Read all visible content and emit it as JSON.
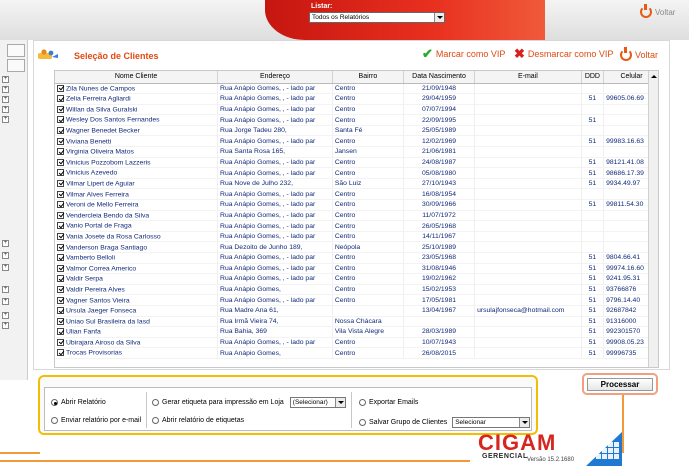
{
  "topbar": {
    "listar_label": "Listar:",
    "listar_value": "Todos os Relatórios",
    "voltar_label": "Voltar"
  },
  "panel": {
    "title": "Seleção de Clientes",
    "marcar_vip": "Marcar como VIP",
    "desmarcar_vip": "Desmarcar como VIP",
    "voltar": "Voltar"
  },
  "table": {
    "columns": [
      "Nome Cliente",
      "Endereço",
      "Bairro",
      "Data Nascimento",
      "E-mail",
      "DDD",
      "Celular"
    ],
    "rows": [
      [
        "Zila Nunes de Campos",
        "Rua Anápio Gomes, , - lado par",
        "Centro",
        "21/09/1948",
        "",
        "",
        ""
      ],
      [
        "Zelia Ferreira Agliardi",
        "Rua Anápio Gomes, , - lado par",
        "Centro",
        "29/04/1959",
        "",
        "51",
        "99605.06.69"
      ],
      [
        "Willan da Silva Guralski",
        "Rua Anápio Gomes, , - lado par",
        "Centro",
        "07/07/1994",
        "",
        "",
        ""
      ],
      [
        "Wesley Dos Santos Fernandes",
        "Rua Anápio Gomes, , - lado par",
        "Centro",
        "22/09/1995",
        "",
        "51",
        ""
      ],
      [
        "Wagner Benedet Becker",
        "Rua Jorge Tadeu 280,",
        "Santa Fé",
        "25/05/1989",
        "",
        "",
        ""
      ],
      [
        "Viviana Benetti",
        "Rua Anápio Gomes, , - lado par",
        "Centro",
        "12/02/1969",
        "",
        "51",
        "99983.16.63"
      ],
      [
        "Virginia Oliveira Matos",
        "Rua Santa Rosa 165,",
        "Jansen",
        "21/06/1981",
        "",
        "",
        ""
      ],
      [
        "Vinicius Pozzobom Lazzeris",
        "Rua Anápio Gomes, , - lado par",
        "Centro",
        "24/08/1987",
        "",
        "51",
        "98121.41.08"
      ],
      [
        "Vinicius Azevedo",
        "Rua Anápio Gomes, , - lado par",
        "Centro",
        "05/08/1980",
        "",
        "51",
        "98686.17.39"
      ],
      [
        "Vilmar Lipert de Aguiar",
        "Rua Nove de Julho 232,",
        "São Luiz",
        "27/10/1943",
        "",
        "51",
        "9934.49.97"
      ],
      [
        "Vilmar Alves Ferreira",
        "Rua Anápio Gomes, , - lado par",
        "Centro",
        "16/08/1954",
        "",
        "",
        ""
      ],
      [
        "Veroni de Mello Ferreira",
        "Rua Anápio Gomes, , - lado par",
        "Centro",
        "30/09/1966",
        "",
        "51",
        "99811.54.30"
      ],
      [
        "Vendercleia Bendo da Silva",
        "Rua Anápio Gomes, , - lado par",
        "Centro",
        "11/07/1972",
        "",
        "",
        ""
      ],
      [
        "Vanio Portal de Fraga",
        "Rua Anápio Gomes, , - lado par",
        "Centro",
        "26/05/1968",
        "",
        "",
        ""
      ],
      [
        "Vania Josete da Rosa Carlosso",
        "Rua Anápio Gomes, , - lado par",
        "Centro",
        "14/11/1967",
        "",
        "",
        ""
      ],
      [
        "Vanderson Braga Santiago",
        "Rua Dezoito de Junho 189,",
        "Neópola",
        "25/10/1989",
        "",
        "",
        ""
      ],
      [
        "Vamberto Belloli",
        "Rua Anápio Gomes, , - lado par",
        "Centro",
        "23/05/1968",
        "",
        "51",
        "9804.66.41"
      ],
      [
        "Valmor Correa Americo",
        "Rua Anápio Gomes, , - lado par",
        "Centro",
        "31/08/1946",
        "",
        "51",
        "99974.16.60"
      ],
      [
        "Valdir Serpa",
        "Rua Anápio Gomes, , - lado par",
        "Centro",
        "19/02/1962",
        "",
        "51",
        "9241.95.31"
      ],
      [
        "Valdir Pereira Alves",
        "Rua Anápio Gomes,",
        "Centro",
        "15/02/1953",
        "",
        "51",
        "93766876"
      ],
      [
        "Vagner Santos Vieira",
        "Rua Anápio Gomes, , - lado par",
        "Centro",
        "17/05/1981",
        "",
        "51",
        "9796.14.40"
      ],
      [
        "Ursula Jaeger Fonseca",
        "Rua Madre Ana 61,",
        "",
        "13/04/1967",
        "ursulajfonseca@hotmail.com",
        "51",
        "92687842"
      ],
      [
        "Uniao Sul Brasileira da Iasd",
        "Rua Irmã Vieira 74,",
        "Nossa Chácara",
        "",
        "",
        "51",
        "91316000"
      ],
      [
        "Ulian Fanfa",
        "Rua Bahia, 369",
        "Vila Vista Alegre",
        "28/03/1989",
        "",
        "51",
        "992301570"
      ],
      [
        "Ubirajara Airoso da Silva",
        "Rua Anápio Gomes, , - lado par",
        "Centro",
        "10/07/1943",
        "",
        "51",
        "99908.05.23"
      ],
      [
        "Trocas Provisorias",
        "Rua Anápio Gomes,",
        "Centro",
        "26/08/2015",
        "",
        "51",
        "99996735"
      ]
    ]
  },
  "options": {
    "abrir_relatorio": "Abrir Relatório",
    "enviar_relatorio": "Enviar relatório por e-mail",
    "gerar_etiqueta": "Gerar etiqueta para impressão em Loja",
    "etiqueta_select": "(Selecionar)",
    "abrir_etiquetas": "Abrir relatório de etiquetas",
    "exportar_emails": "Exportar Emails",
    "salvar_grupo": "Salvar Grupo de Clientes",
    "grupo_select": "Selecionar"
  },
  "processar": "Processar",
  "brand": {
    "name": "CIGAM",
    "sub": "GERENCIAL",
    "version": "Versão 15.2.1680"
  },
  "colors": {
    "accent": "#e04a12",
    "text_blue": "#102a7a",
    "highlight": "#f0c000"
  }
}
